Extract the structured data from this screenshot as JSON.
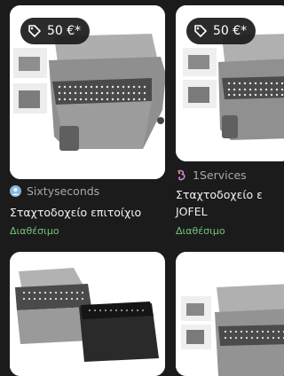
{
  "colors": {
    "background": "#1b1b1b",
    "available": "#74c47b",
    "badge_bg": "#191919"
  },
  "listings": [
    {
      "price": "50 €*",
      "price_icon": "tag-icon",
      "seller": "Sixtyseconds",
      "seller_icon": "avatar-icon",
      "title": "Σταχτοδοχείο επιτοίχιο",
      "availability": "Διαθέσιμο"
    },
    {
      "price": "50 €*",
      "price_icon": "tag-icon",
      "seller": "1Services",
      "seller_icon": "brand-logo-icon",
      "title_line1": "Σταχτοδοχείο ε",
      "title_line2": "JOFEL",
      "availability": "Διαθέσιμο"
    }
  ]
}
